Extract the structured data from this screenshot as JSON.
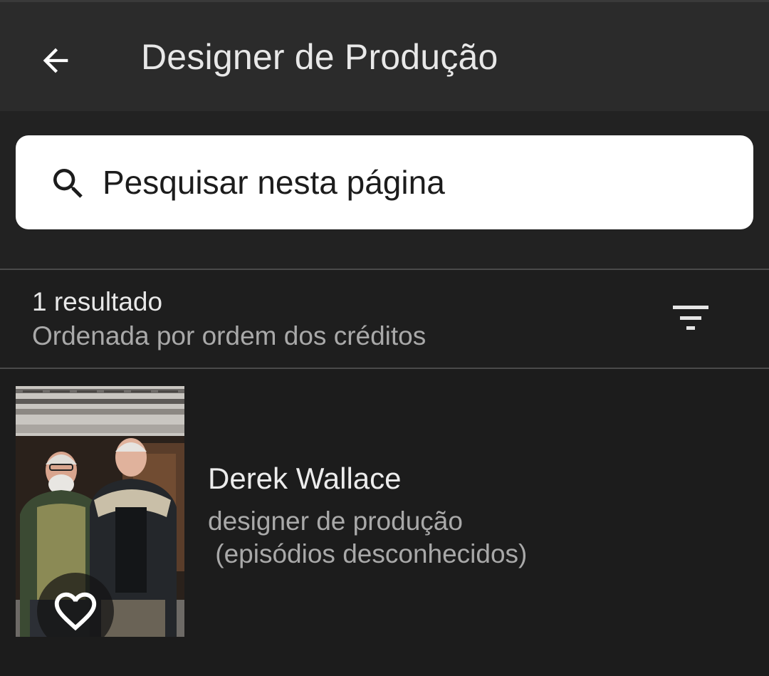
{
  "header": {
    "title": "Designer de Produção",
    "back_icon": "arrow-left-icon"
  },
  "search": {
    "placeholder": "Pesquisar nesta página",
    "icon": "search-icon"
  },
  "results": {
    "count_text": "1 resultado",
    "sort_text": "Ordenada por ordem dos créditos",
    "filter_icon": "filter-sort-icon"
  },
  "items": [
    {
      "name": "Derek Wallace",
      "role": "designer de produção",
      "episodes": " (episódios desconhecidos)",
      "favorite_icon": "heart-outline-icon"
    }
  ],
  "colors": {
    "topbar": "#2b2b2b",
    "background": "#1f1f1f",
    "primary_text": "#e8e8e8",
    "secondary_text": "#a9a9a9",
    "search_bg": "#ffffff"
  }
}
